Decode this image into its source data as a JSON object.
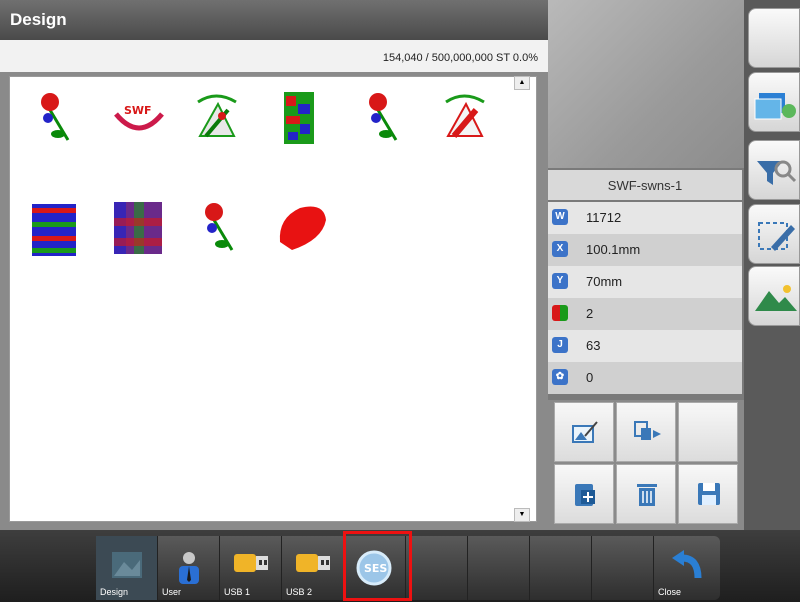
{
  "title": "Design",
  "stitch_status": "154,040 / 500,000,000 ST  0.0%",
  "designs": [
    {
      "name": "rose-design-icon"
    },
    {
      "name": "swf-logo-design-icon"
    },
    {
      "name": "swf-swns-design-icon"
    },
    {
      "name": "multicolor-rose-design-icon"
    },
    {
      "name": "rose-design-icon"
    },
    {
      "name": "swf-swns-red-design-icon"
    },
    {
      "name": "pattern-grid-design-icon"
    },
    {
      "name": "pattern-checker-design-icon"
    },
    {
      "name": "rose-design-icon"
    },
    {
      "name": "red-fill-design-icon"
    }
  ],
  "info": {
    "name": "SWF-swns-1",
    "stitches": "11712",
    "width": "100.1mm",
    "height": "70mm",
    "colors": "2",
    "jumps": "63",
    "extra": "0"
  },
  "toolbar": {
    "design": "Design",
    "user": "User",
    "usb1": "USB 1",
    "usb2": "USB 2",
    "ses": "SES",
    "close": "Close"
  },
  "colors": {
    "highlight": "#e11111",
    "accent": "#3c73c8"
  }
}
